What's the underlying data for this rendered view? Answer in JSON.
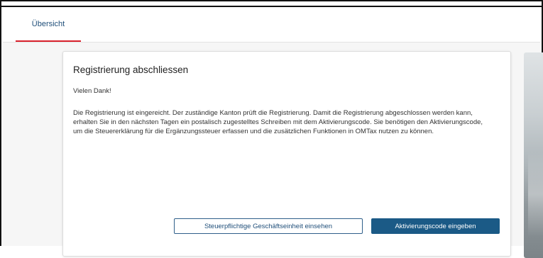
{
  "tabs": [
    {
      "label": "Übersicht",
      "active": true
    }
  ],
  "card": {
    "title": "Registrierung abschliessen",
    "subtitle": "Vielen Dank!",
    "body": "Die Registrierung ist eingereicht. Der zuständige Kanton prüft die Registrierung. Damit die Registrierung abgeschlossen werden kann, erhalten Sie in den nächsten Tagen ein postalisch zugestelltes Schreiben mit dem Aktivierungscode. Sie benötigen den Aktivierungscode, um die Steuererklärung für die Ergänzungssteuer erfassen und die zusätzlichen Funktionen in OMTax nutzen zu können.",
    "buttons": {
      "secondary_label": "Steuerpflichtige Geschäftseinheit einsehen",
      "primary_label": "Aktivierungscode eingeben"
    }
  },
  "colors": {
    "accent_red": "#d9212c",
    "primary_blue": "#1b5a86",
    "link_blue": "#1f4e79"
  }
}
